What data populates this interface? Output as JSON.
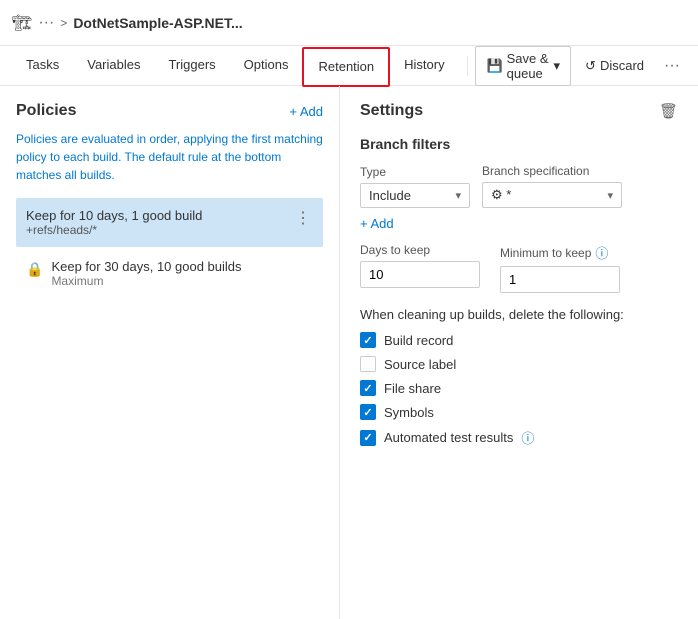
{
  "header": {
    "icon": "🏗",
    "dots": "···",
    "chevron": ">",
    "title": "DotNetSample-ASP.NET..."
  },
  "nav": {
    "tabs": [
      {
        "id": "tasks",
        "label": "Tasks",
        "active": false,
        "highlighted": false
      },
      {
        "id": "variables",
        "label": "Variables",
        "active": false,
        "highlighted": false
      },
      {
        "id": "triggers",
        "label": "Triggers",
        "active": false,
        "highlighted": false
      },
      {
        "id": "options",
        "label": "Options",
        "active": false,
        "highlighted": false
      },
      {
        "id": "retention",
        "label": "Retention",
        "active": true,
        "highlighted": true
      },
      {
        "id": "history",
        "label": "History",
        "active": false,
        "highlighted": false
      }
    ],
    "save_queue": "Save & queue",
    "discard": "Discard"
  },
  "policies": {
    "title": "Policies",
    "add_label": "+ Add",
    "description": "Policies are evaluated in order, applying the first matching policy to each build. The default rule at the bottom matches all builds.",
    "items": [
      {
        "id": "policy1",
        "name": "Keep for 10 days, 1 good build",
        "sub": "+refs/heads/*",
        "selected": true,
        "locked": false
      },
      {
        "id": "policy2",
        "name": "Keep for 30 days, 10 good builds",
        "sub": "Maximum",
        "selected": false,
        "locked": true
      }
    ]
  },
  "settings": {
    "title": "Settings",
    "branch_filters_title": "Branch filters",
    "type_label": "Type",
    "type_value": "Include",
    "branch_spec_label": "Branch specification",
    "branch_spec_value": "⚙ *",
    "add_filter_label": "+ Add",
    "days_to_keep_label": "Days to keep",
    "days_to_keep_value": "10",
    "min_to_keep_label": "Minimum to keep",
    "min_to_keep_value": "1",
    "cleanup_label": "When cleaning up builds, delete the following:",
    "checkboxes": [
      {
        "id": "build_record",
        "label": "Build record",
        "checked": true
      },
      {
        "id": "source_label",
        "label": "Source label",
        "checked": false
      },
      {
        "id": "file_share",
        "label": "File share",
        "checked": true
      },
      {
        "id": "symbols",
        "label": "Symbols",
        "checked": true
      },
      {
        "id": "automated_test",
        "label": "Automated test results",
        "checked": true,
        "info": true
      }
    ]
  }
}
